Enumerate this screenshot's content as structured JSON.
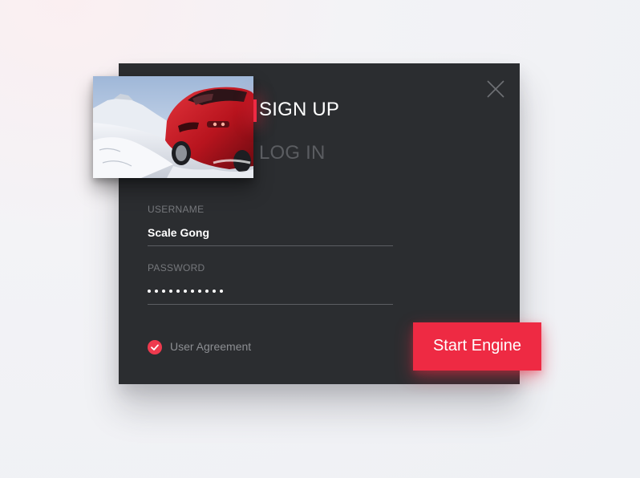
{
  "dialog": {
    "tabs": [
      {
        "label": "SIGN UP",
        "active": true
      },
      {
        "label": "LOG IN",
        "active": false
      }
    ],
    "close_icon": "close-icon",
    "photo_icon": "red-car-in-snow-photo"
  },
  "form": {
    "username": {
      "label": "USERNAME",
      "value": "Scale Gong"
    },
    "password": {
      "label": "PASSWORD",
      "masked_length": 11
    },
    "agreement": {
      "label": "User Agreement",
      "checked": true
    }
  },
  "cta": {
    "label": "Start Engine"
  },
  "colors": {
    "accent": "#ee2a43",
    "panel": "#2b2d30",
    "text": "#ffffff",
    "muted": "#5b5d61"
  }
}
